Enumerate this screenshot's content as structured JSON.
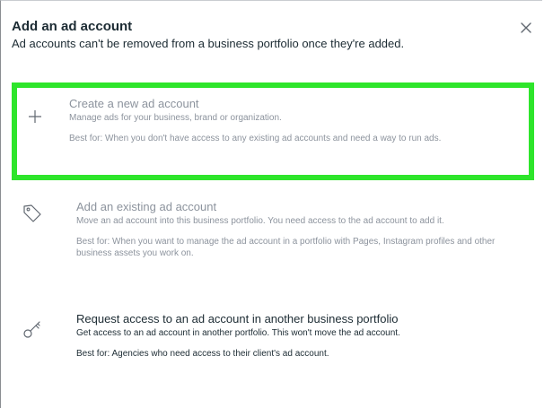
{
  "dialog": {
    "title": "Add an ad account",
    "subtitle": "Ad accounts can't be removed from a business portfolio once they're added.",
    "close_icon": "close-icon"
  },
  "options": [
    {
      "icon": "plus-icon",
      "title": "Create a new ad account",
      "description": "Manage ads for your business, brand or organization.",
      "best_for": "Best for: When you don't have access to any existing ad accounts and need a way to run ads.",
      "selected": true
    },
    {
      "icon": "tag-icon",
      "title": "Add an existing ad account",
      "description": "Move an ad account into this business portfolio. You need access to the ad account to add it.",
      "best_for": "Best for: When you want to manage the ad account in a portfolio with Pages, Instagram profiles and other business assets you work on.",
      "selected": false
    },
    {
      "icon": "key-icon",
      "title": "Request access to an ad account in another business portfolio",
      "description": "Get access to an ad account in another portfolio. This won't move the ad account.",
      "best_for": "Best for: Agencies who need access to their client's ad account.",
      "selected": false
    }
  ],
  "colors": {
    "highlight": "#2ee52b",
    "text": "#1c2b33",
    "muted_text": "#8c939d"
  }
}
